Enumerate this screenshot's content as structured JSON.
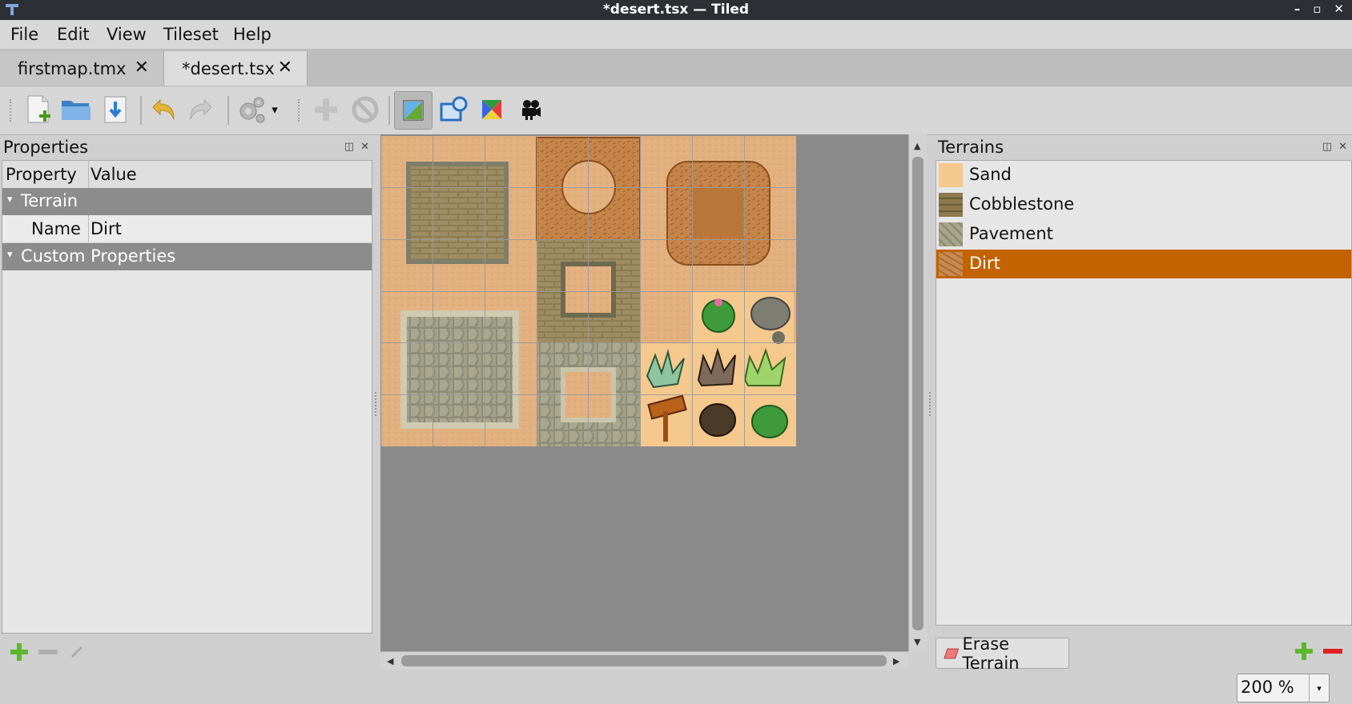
{
  "window": {
    "title": "*desert.tsx — Tiled",
    "buttons": [
      "–",
      "▫",
      "✕"
    ]
  },
  "menu": [
    "File",
    "Edit",
    "View",
    "Tileset",
    "Help"
  ],
  "tabs": [
    {
      "label": "firstmap.tmx",
      "close": "✕",
      "active": false
    },
    {
      "label": "*desert.tsx",
      "close": "✕",
      "active": true
    }
  ],
  "toolbar": {
    "icons": [
      "new-file-icon",
      "open-folder-icon",
      "save-icon",
      "undo-icon",
      "redo-icon",
      "settings-icon",
      "add-tiles-icon",
      "remove-tiles-icon",
      "terrain-brush-icon",
      "collision-editor-icon",
      "color-edit-icon",
      "animation-editor-icon"
    ],
    "checked": "terrain-brush-icon",
    "dropdown_glyph": "▾"
  },
  "properties": {
    "title": "Properties",
    "dock_btns": [
      "◫",
      "✕"
    ],
    "col_property": "Property",
    "col_value": "Value",
    "group_terrain": "Terrain",
    "row_name_label": "Name",
    "row_name_value": "Dirt",
    "group_custom": "Custom Properties",
    "arrow": "▾"
  },
  "terrains": {
    "title": "Terrains",
    "dock_btns": [
      "◫",
      "✕"
    ],
    "items": [
      {
        "name": "Sand",
        "color": "#f5c88e"
      },
      {
        "name": "Cobblestone",
        "color": "#8c7a4e"
      },
      {
        "name": "Pavement",
        "color": "#a7a58a"
      },
      {
        "name": "Dirt",
        "color": "#c98a4f"
      }
    ],
    "selected": "Dirt",
    "erase_label": "Erase Terrain"
  },
  "zoom": {
    "value": "200 %",
    "arrow": "▾"
  },
  "colors": {
    "selection": "#c36200",
    "sand": "#e3b07e",
    "canvas": "#8a8a8a"
  }
}
